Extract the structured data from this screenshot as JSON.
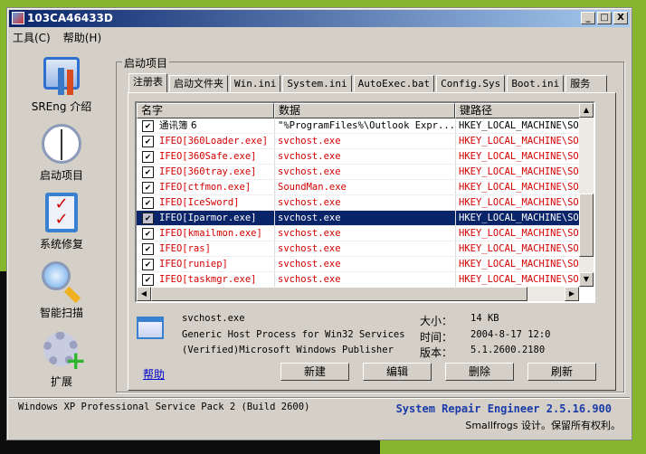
{
  "window": {
    "title": "103CA46433D",
    "buttons": {
      "minimize": "_",
      "maximize": "□",
      "close": "X"
    }
  },
  "menu": [
    "工具(C)",
    "帮助(H)"
  ],
  "sidebar": [
    {
      "label": "SREng 介绍",
      "icon": "tools-icon"
    },
    {
      "label": "启动项目",
      "icon": "clock-icon"
    },
    {
      "label": "系统修复",
      "icon": "checklist-icon"
    },
    {
      "label": "智能扫描",
      "icon": "magnifier-icon"
    },
    {
      "label": "扩展",
      "icon": "gear-plus-icon"
    }
  ],
  "group_label": "启动项目",
  "tabs": [
    "注册表",
    "启动文件夹",
    "Win.ini",
    "System.ini",
    "AutoExec.bat",
    "Config.Sys",
    "Boot.ini",
    "服务"
  ],
  "columns": [
    "名字",
    "数据",
    "键路径"
  ],
  "rows": [
    {
      "name": "通讯簿 6",
      "data": "\"%ProgramFiles%\\Outlook Expr...",
      "path": "HKEY_LOCAL_MACHINE\\SOFT",
      "red": false
    },
    {
      "name": "IFEO[360Loader.exe]",
      "data": "svchost.exe",
      "path": "HKEY_LOCAL_MACHINE\\SOFT",
      "red": true
    },
    {
      "name": "IFEO[360Safe.exe]",
      "data": "svchost.exe",
      "path": "HKEY_LOCAL_MACHINE\\SOFT",
      "red": true
    },
    {
      "name": "IFEO[360tray.exe]",
      "data": "svchost.exe",
      "path": "HKEY_LOCAL_MACHINE\\SOFT",
      "red": true
    },
    {
      "name": "IFEO[ctfmon.exe]",
      "data": "SoundMan.exe",
      "path": "HKEY_LOCAL_MACHINE\\SOFT",
      "red": true
    },
    {
      "name": "IFEO[IceSword]",
      "data": "svchost.exe",
      "path": "HKEY_LOCAL_MACHINE\\SOFT",
      "red": true
    },
    {
      "name": "IFEO[Iparmor.exe]",
      "data": "svchost.exe",
      "path": "HKEY_LOCAL_MACHINE\\SOFT",
      "red": true,
      "selected": true
    },
    {
      "name": "IFEO[kmailmon.exe]",
      "data": "svchost.exe",
      "path": "HKEY_LOCAL_MACHINE\\SOFT",
      "red": true
    },
    {
      "name": "IFEO[ras]",
      "data": "svchost.exe",
      "path": "HKEY_LOCAL_MACHINE\\SOFT",
      "red": true
    },
    {
      "name": "IFEO[runiep]",
      "data": "svchost.exe",
      "path": "HKEY_LOCAL_MACHINE\\SOFT",
      "red": true
    },
    {
      "name": "IFEO[taskmgr.exe]",
      "data": "svchost.exe",
      "path": "HKEY_LOCAL_MACHINE\\SOFT",
      "red": true
    }
  ],
  "details": {
    "file": "svchost.exe",
    "description": "Generic Host Process for Win32 Services",
    "publisher": "(Verified)Microsoft Windows Publisher",
    "size_label": "大小：",
    "size": "14 KB",
    "time_label": "时间：",
    "time": "2004-8-17 12:0",
    "version_label": "版本：",
    "version": "5.1.2600.2180"
  },
  "help_link": "帮助",
  "buttons": {
    "new": "新建",
    "edit": "编辑",
    "delete": "删除",
    "refresh": "刷新"
  },
  "status": {
    "os": "Windows XP Professional Service Pack 2 (Build 2600)",
    "product": "System Repair Engineer 2.5.16.900",
    "copyright": "Smallfrogs 设计。保留所有权利。"
  },
  "colors": {
    "red": "#d40000",
    "selection": "#0a246a",
    "product": "#1a3aa8"
  }
}
